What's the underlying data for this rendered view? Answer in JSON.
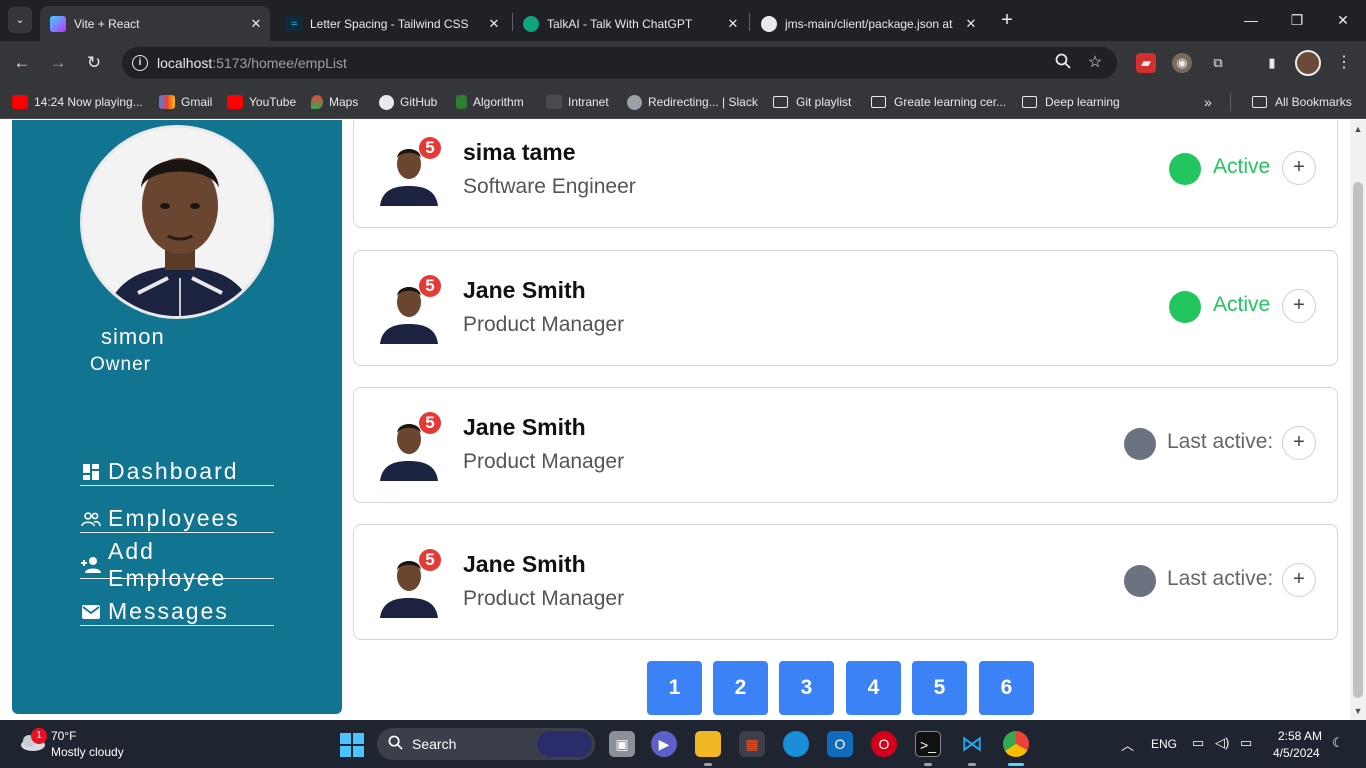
{
  "browser": {
    "tabs": [
      {
        "title": "Vite + React",
        "favicon_color": "#7c6df2",
        "active": true
      },
      {
        "title": "Letter Spacing - Tailwind CSS",
        "favicon_color": "#38bdf8",
        "active": false
      },
      {
        "title": "TalkAI - Talk With ChatGPT",
        "favicon_color": "#10a37f",
        "active": false
      },
      {
        "title": "jms-main/client/package.json at",
        "favicon_color": "#e8eaed",
        "active": false
      }
    ],
    "url_host": "localhost",
    "url_path": ":5173/homee/empList",
    "bookmarks": [
      {
        "label": "14:24 Now playing...",
        "icon": "youtube-icon",
        "color": "#ff0000"
      },
      {
        "label": "Gmail",
        "icon": "gmail-icon",
        "color": "#ea4335"
      },
      {
        "label": "YouTube",
        "icon": "youtube-icon",
        "color": "#ff0000"
      },
      {
        "label": "Maps",
        "icon": "maps-icon",
        "color": "#34a853"
      },
      {
        "label": "GitHub",
        "icon": "github-icon",
        "color": "#e8eaed"
      },
      {
        "label": "Algorithm",
        "icon": "algorithm-icon",
        "color": "#2e7d32"
      },
      {
        "label": "Intranet",
        "icon": "intranet-icon",
        "color": "#5f6368"
      },
      {
        "label": "Redirecting... | Slack",
        "icon": "globe-icon",
        "color": "#9aa0a6"
      },
      {
        "label": "Git playlist",
        "icon": "folder-icon",
        "color": ""
      },
      {
        "label": "Greate learning cer...",
        "icon": "folder-icon",
        "color": ""
      },
      {
        "label": "Deep learning",
        "icon": "folder-icon",
        "color": ""
      }
    ],
    "all_bookmarks": "All Bookmarks"
  },
  "sidebar": {
    "user_name": "simon",
    "user_role": "Owner",
    "nav": [
      {
        "label": "Dashboard",
        "icon": "dashboard-icon"
      },
      {
        "label": "Employees",
        "icon": "people-icon"
      },
      {
        "label": "Add Employee",
        "icon": "person-add-icon"
      },
      {
        "label": "Messages",
        "icon": "mail-icon"
      }
    ]
  },
  "employees": [
    {
      "name": "sima tame",
      "title": "Software Engineer",
      "badge": "5",
      "status": "Active",
      "status_color": "#22c55e"
    },
    {
      "name": "Jane Smith",
      "title": "Product Manager",
      "badge": "5",
      "status": "Active",
      "status_color": "#22c55e"
    },
    {
      "name": "Jane Smith",
      "title": "Product Manager",
      "badge": "5",
      "status": "Last active:",
      "status_color": "#6b7280"
    },
    {
      "name": "Jane Smith",
      "title": "Product Manager",
      "badge": "5",
      "status": "Last active:",
      "status_color": "#6b7280"
    }
  ],
  "pagination": [
    "1",
    "2",
    "3",
    "4",
    "5",
    "6"
  ],
  "colors": {
    "sidebar": "#117491",
    "pager": "#3b82f6",
    "active": "#22c55e",
    "inactive": "#6b7280"
  },
  "taskbar": {
    "weather_temp": "70°F",
    "weather_desc": "Mostly cloudy",
    "weather_badge": "1",
    "search_label": "Search",
    "language": "ENG",
    "time": "2:58 AM",
    "date": "4/5/2024"
  }
}
